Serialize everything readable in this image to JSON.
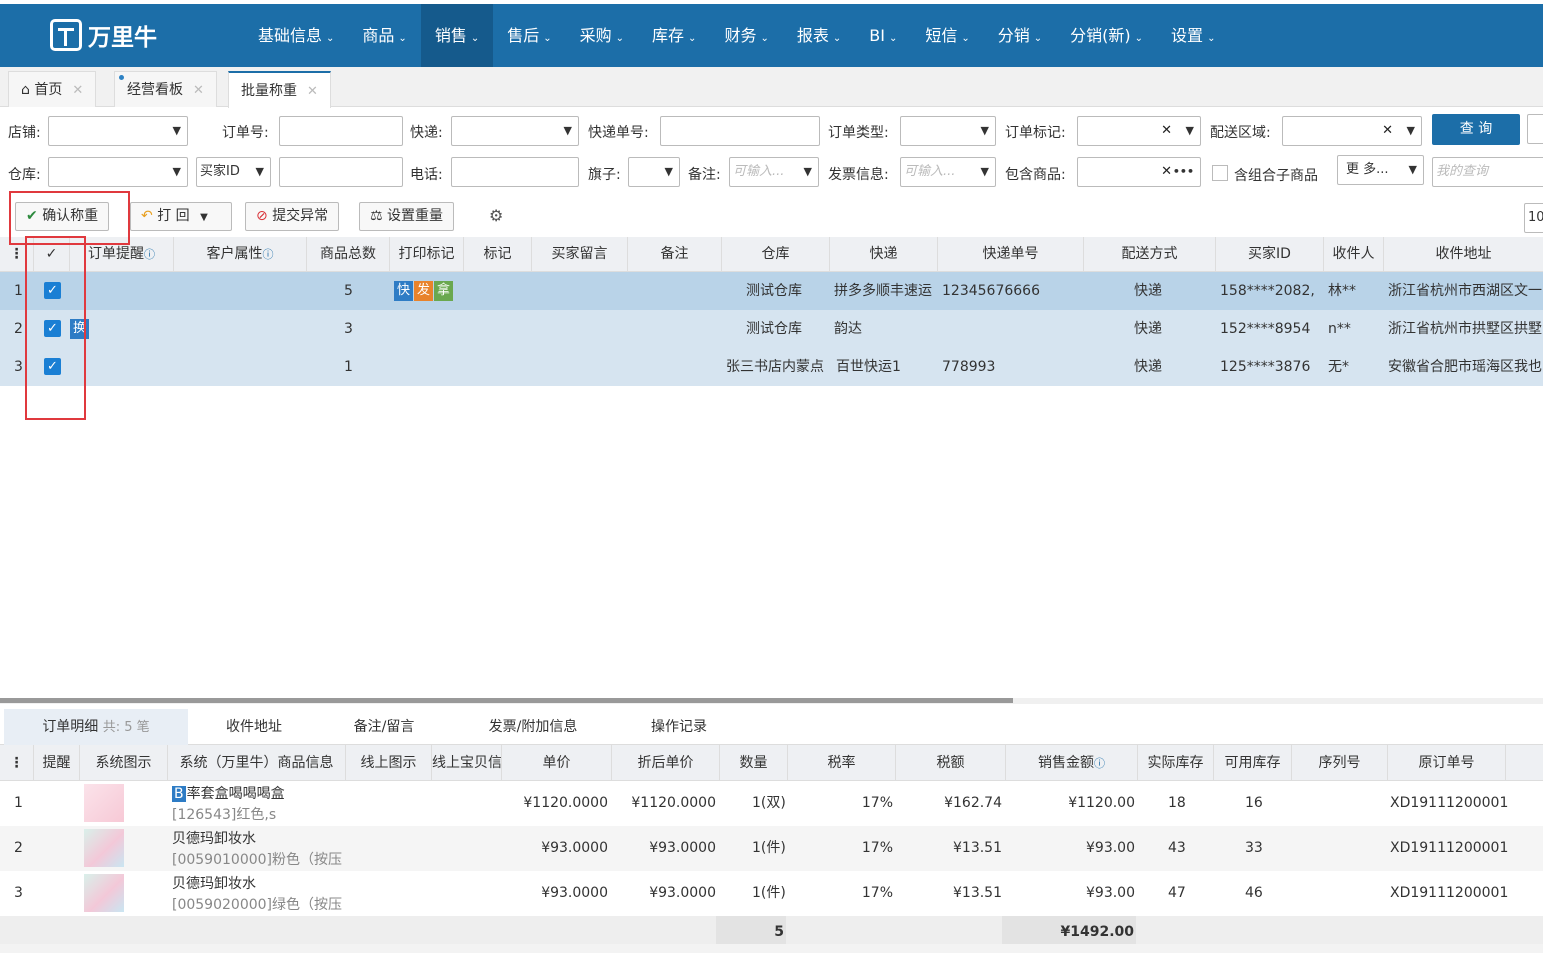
{
  "app": {
    "logo_text": "万里牛"
  },
  "nav": [
    {
      "label": "基础信息"
    },
    {
      "label": "商品"
    },
    {
      "label": "销售",
      "active": true
    },
    {
      "label": "售后"
    },
    {
      "label": "采购"
    },
    {
      "label": "库存"
    },
    {
      "label": "财务"
    },
    {
      "label": "报表"
    },
    {
      "label": "BI"
    },
    {
      "label": "短信"
    },
    {
      "label": "分销"
    },
    {
      "label": "分销(新)"
    },
    {
      "label": "设置"
    }
  ],
  "tabs": [
    {
      "label": "首页"
    },
    {
      "label": "经营看板"
    },
    {
      "label": "批量称重",
      "active": true
    }
  ],
  "filters": {
    "shop": "店铺:",
    "order_no": "订单号:",
    "express": "快递:",
    "tracking_no": "快递单号:",
    "order_type": "订单类型:",
    "order_mark": "订单标记:",
    "region": "配送区域:",
    "warehouse": "仓库:",
    "buyer_id_select": "买家ID",
    "phone": "电话:",
    "flag": "旗子:",
    "remark": "备注:",
    "remark_placeholder": "可输入...",
    "invoice": "发票信息:",
    "invoice_placeholder": "可输入...",
    "contains": "包含商品:",
    "combo": "含组合子商品",
    "more": "更 多...",
    "my_query_placeholder": "我的查询",
    "search": "查 询",
    "page_size": "10"
  },
  "toolbar": {
    "confirm": "确认称重",
    "print": "打 回",
    "submit_err": "提交异常",
    "set_weight": "设置重量"
  },
  "grid": {
    "headers": {
      "remind": "订单提醒",
      "cust": "客户属性",
      "total": "商品总数",
      "print_mark": "打印标记",
      "mark": "标记",
      "msg": "买家留言",
      "remark": "备注",
      "wh": "仓库",
      "exp": "快递",
      "track": "快递单号",
      "ship": "配送方式",
      "buyer": "买家ID",
      "recv": "收件人",
      "addr": "收件地址"
    },
    "rows": [
      {
        "n": "1",
        "total": "5",
        "tags": [
          "快",
          "发",
          "拿"
        ],
        "wh": "测试仓库",
        "exp": "拼多多顺丰速运",
        "track": "12345676666",
        "ship": "快递",
        "buyer": "158****2082,",
        "recv": "林**",
        "addr": "浙江省杭州市西湖区文一"
      },
      {
        "n": "2",
        "remind": "换",
        "total": "3",
        "wh": "测试仓库",
        "exp": "韵达",
        "track": "",
        "ship": "快递",
        "buyer": "152****8954",
        "recv": "n**",
        "addr": "浙江省杭州市拱墅区拱墅"
      },
      {
        "n": "3",
        "total": "1",
        "wh": "张三书店内蒙点",
        "exp": "百世快运1",
        "track": "778993",
        "ship": "快递",
        "buyer": "125****3876",
        "recv": "无*",
        "addr": "安徽省合肥市瑶海区我也"
      }
    ]
  },
  "bottom_tabs": {
    "detail": "订单明细",
    "count": "共: 5 笔",
    "address": "收件地址",
    "remark": "备注/留言",
    "invoice": "发票/附加信息",
    "log": "操作记录"
  },
  "detail": {
    "headers": {
      "remind": "提醒",
      "img": "系统图示",
      "info": "系统（万里牛）商品信息",
      "online_img": "线上图示",
      "online_item": "线上宝贝信息",
      "price": "单价",
      "disc": "折后单价",
      "qty": "数量",
      "tax_rate": "税率",
      "tax": "税额",
      "amount": "销售金额",
      "stock": "实际库存",
      "avail": "可用库存",
      "serial": "序列号",
      "orig": "原订单号"
    },
    "rows": [
      {
        "n": "1",
        "badge": "B",
        "name": "率套盒喝喝喝盒",
        "sku": "[126543]红色,s",
        "price": "¥1120.0000",
        "disc": "¥1120.0000",
        "qty": "1(双)",
        "rate": "17%",
        "tax": "¥162.74",
        "amount": "¥1120.00",
        "stock": "18",
        "avail": "16",
        "orig": "XD19111200001"
      },
      {
        "n": "2",
        "name": "贝德玛卸妆水",
        "sku": "[0059010000]粉色（按压",
        "price": "¥93.0000",
        "disc": "¥93.0000",
        "qty": "1(件)",
        "rate": "17%",
        "tax": "¥13.51",
        "amount": "¥93.00",
        "stock": "43",
        "avail": "33",
        "orig": "XD19111200001"
      },
      {
        "n": "3",
        "name": "贝德玛卸妆水",
        "sku": "[0059020000]绿色（按压",
        "price": "¥93.0000",
        "disc": "¥93.0000",
        "qty": "1(件)",
        "rate": "17%",
        "tax": "¥13.51",
        "amount": "¥93.00",
        "stock": "47",
        "avail": "46",
        "orig": "XD19111200001"
      }
    ],
    "footer": {
      "qty": "5",
      "amount": "¥1492.00"
    }
  },
  "colors": {
    "brand": "#1c6ea8",
    "selected_row": "#b9d3e8",
    "row": "#d6e4f0",
    "highlight": "#e0393e"
  }
}
